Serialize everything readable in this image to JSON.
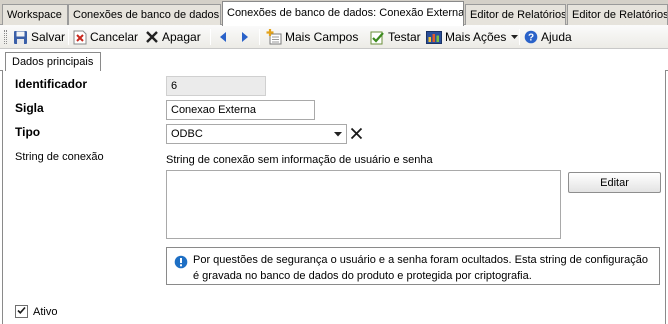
{
  "tabs": [
    {
      "label": "Workspace"
    },
    {
      "label": "Conexões de banco de dados"
    },
    {
      "label": "Conexões de banco de dados: Conexão Externa"
    },
    {
      "label": "Editor de Relatórios"
    },
    {
      "label": "Editor de Relatórios:"
    }
  ],
  "toolbar": {
    "save": "Salvar",
    "cancel": "Cancelar",
    "delete": "Apagar",
    "more_fields": "Mais Campos",
    "test": "Testar",
    "more_actions": "Mais Ações",
    "help": "Ajuda"
  },
  "subtab": {
    "label": "Dados principais"
  },
  "form": {
    "identificador_label": "Identificador",
    "identificador_value": "6",
    "sigla_label": "Sigla",
    "sigla_value": "Conexao Externa",
    "tipo_label": "Tipo",
    "tipo_value": "ODBC",
    "string_label": "String de conexão",
    "string_caption": "String de conexão sem informação de usuário e senha",
    "string_value": "",
    "edit_button": "Editar",
    "info_text": "Por questões de segurança o usuário e a senha foram ocultados. Esta string de configuração é gravada no banco de dados do produto e protegida por criptografia.",
    "ativo_label": "Ativo",
    "ativo_checked": true
  },
  "colors": {
    "info_icon": "#1e6fc4",
    "cancel_icon": "#c8281e"
  }
}
